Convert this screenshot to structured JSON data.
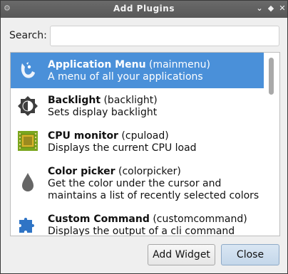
{
  "window": {
    "title": "Add Plugins",
    "controls": [
      "⌄",
      "◆",
      "✕"
    ]
  },
  "search": {
    "label": "Search:",
    "value": "",
    "placeholder": ""
  },
  "plugins": [
    {
      "name": "Application Menu",
      "id": "(mainmenu)",
      "desc": "A menu of all your applications",
      "icon": "application-menu-icon",
      "selected": true
    },
    {
      "name": "Backlight",
      "id": "(backlight)",
      "desc": "Sets display backlight",
      "icon": "backlight-icon",
      "selected": false
    },
    {
      "name": "CPU monitor",
      "id": "(cpuload)",
      "desc": "Displays the current CPU load",
      "icon": "cpu-chip-icon",
      "selected": false
    },
    {
      "name": "Color picker",
      "id": "(colorpicker)",
      "desc": "Get the color under the cursor and",
      "desc2": "maintains a list of recently selected colors",
      "icon": "color-drop-icon",
      "selected": false
    },
    {
      "name": "Custom Command",
      "id": "(customcommand)",
      "desc": "Displays the output of a cli command",
      "icon": "puzzle-piece-icon",
      "selected": false
    }
  ],
  "buttons": {
    "add": "Add Widget",
    "close": "Close"
  },
  "colors": {
    "selection": "#4a90d9",
    "titlebar": "#5f5f5f"
  }
}
